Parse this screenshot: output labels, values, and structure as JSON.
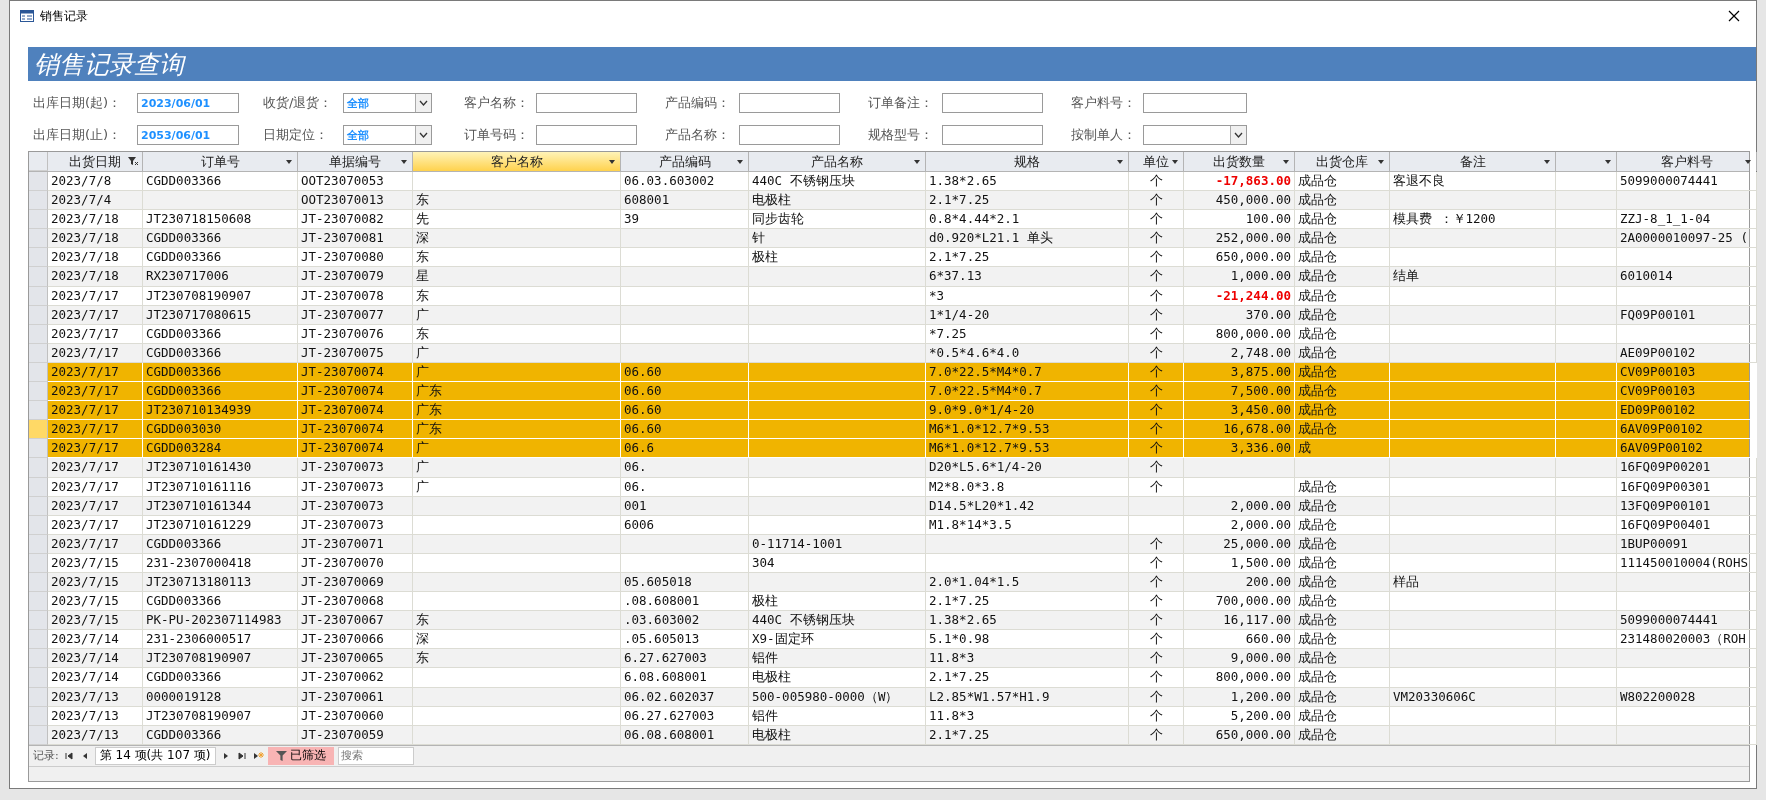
{
  "window": {
    "title": "销售记录"
  },
  "banner": {
    "title": "销售记录查询"
  },
  "filters": [
    [
      {
        "label": "出库日期(起)：",
        "kind": "date",
        "value": "2023/06/01"
      },
      {
        "label": "收货/退货：",
        "kind": "combo",
        "value": "全部"
      },
      {
        "label": "客户名称：",
        "kind": "text"
      },
      {
        "label": "产品编码：",
        "kind": "text"
      },
      {
        "label": "订单备注：",
        "kind": "text"
      },
      {
        "label": "客户料号：",
        "kind": "text"
      }
    ],
    [
      {
        "label": "出库日期(止)：",
        "kind": "date",
        "value": "2053/06/01"
      },
      {
        "label": "日期定位：",
        "kind": "combo",
        "value": "全部"
      },
      {
        "label": "订单号码：",
        "kind": "text"
      },
      {
        "label": "产品名称：",
        "kind": "text"
      },
      {
        "label": "规格型号：",
        "kind": "text"
      },
      {
        "label": "按制单人：",
        "kind": "combo"
      }
    ]
  ],
  "table": {
    "columns": [
      {
        "label": "出货日期",
        "selected": false,
        "filtered": true
      },
      {
        "label": "订单号",
        "selected": false,
        "filtered": false
      },
      {
        "label": "单据编号",
        "selected": false,
        "filtered": false
      },
      {
        "label": "客户名称",
        "selected": true,
        "filtered": false
      },
      {
        "label": "产品编码",
        "selected": false,
        "filtered": false
      },
      {
        "label": "产品名称",
        "selected": false,
        "filtered": false
      },
      {
        "label": "规格",
        "selected": false,
        "filtered": false
      },
      {
        "label": "单位",
        "selected": false,
        "filtered": false
      },
      {
        "label": "出货数量",
        "selected": false,
        "filtered": false
      },
      {
        "label": "出货仓库",
        "selected": false,
        "filtered": false
      },
      {
        "label": "备注",
        "selected": false,
        "filtered": false
      },
      {
        "selected": false,
        "filtered": false
      },
      {
        "label": "客户料号",
        "selected": false,
        "filtered": false
      }
    ],
    "rows": [
      {
        "selected": false,
        "current": false,
        "negative": true,
        "ship_date": "2023/7/8",
        "order_no": "CGDD003366",
        "doc_no": "OOT23070053",
        "product_code": "06.03.603002",
        "product_name": "440C 不锈钢压块",
        "spec": "1.38*2.65",
        "unit": "个",
        "qty": "-17,863.00",
        "warehouse": "成品仓",
        "note": "客退不良",
        "customer_part": "5099000074441"
      },
      {
        "selected": false,
        "current": false,
        "negative": false,
        "ship_date": "2023/7/4",
        "doc_no": "OOT23070013",
        "customer": "东",
        "product_code": "608001",
        "product_name": "电极柱",
        "spec": "2.1*7.25",
        "unit": "个",
        "qty": "450,000.00",
        "warehouse": "成品仓"
      },
      {
        "selected": false,
        "current": false,
        "negative": false,
        "ship_date": "2023/7/18",
        "order_no": "JT230718150608",
        "doc_no": "JT-23070082",
        "customer": "先",
        "product_code": "39",
        "product_name": "同步齿轮",
        "spec": "0.8*4.44*2.1",
        "unit": "个",
        "qty": "100.00",
        "warehouse": "成品仓",
        "note": "模具费 ：￥1200",
        "customer_part": "ZZJ-8_1_1-04"
      },
      {
        "selected": false,
        "current": false,
        "negative": false,
        "ship_date": "2023/7/18",
        "order_no": "CGDD003366",
        "doc_no": "JT-23070081",
        "customer": "深",
        "product_name": "针",
        "spec": "d0.920*L21.1 单头",
        "unit": "个",
        "qty": "252,000.00",
        "warehouse": "成品仓",
        "customer_part": "2A0000010097-25 ("
      },
      {
        "selected": false,
        "current": false,
        "negative": false,
        "ship_date": "2023/7/18",
        "order_no": "CGDD003366",
        "doc_no": "JT-23070080",
        "customer": "东",
        "product_name": "极柱",
        "spec": "2.1*7.25",
        "unit": "个",
        "qty": "650,000.00",
        "warehouse": "成品仓"
      },
      {
        "selected": false,
        "current": false,
        "negative": false,
        "ship_date": "2023/7/18",
        "order_no": "RX230717006",
        "doc_no": "JT-23070079",
        "customer": "星",
        "spec": "6*37.13",
        "unit": "个",
        "qty": "1,000.00",
        "warehouse": "成品仓",
        "note": "结单",
        "customer_part": "6010014"
      },
      {
        "selected": false,
        "current": false,
        "negative": true,
        "ship_date": "2023/7/17",
        "order_no": "JT230708190907",
        "doc_no": "JT-23070078",
        "customer": "东",
        "spec": "*3",
        "unit": "个",
        "qty": "-21,244.00",
        "warehouse": "成品仓"
      },
      {
        "selected": false,
        "current": false,
        "negative": false,
        "ship_date": "2023/7/17",
        "order_no": "JT230717080615",
        "doc_no": "JT-23070077",
        "customer": "广",
        "spec": "1*1/4-20",
        "unit": "个",
        "qty": "370.00",
        "warehouse": "成品仓",
        "customer_part": "FQ09P00101"
      },
      {
        "selected": false,
        "current": false,
        "negative": false,
        "ship_date": "2023/7/17",
        "order_no": "CGDD003366",
        "doc_no": "JT-23070076",
        "customer": "东",
        "spec": "*7.25",
        "unit": "个",
        "qty": "800,000.00",
        "warehouse": "成品仓"
      },
      {
        "selected": false,
        "current": false,
        "negative": false,
        "ship_date": "2023/7/17",
        "order_no": "CGDD003366",
        "doc_no": "JT-23070075",
        "customer": "广",
        "spec": "*0.5*4.6*4.0",
        "unit": "个",
        "qty": "2,748.00",
        "warehouse": "成品仓",
        "customer_part": "AE09P00102"
      },
      {
        "selected": true,
        "current": false,
        "negative": false,
        "ship_date": "2023/7/17",
        "order_no": "CGDD003366",
        "doc_no": "JT-23070074",
        "customer": "广",
        "product_code": "06.60",
        "spec": "7.0*22.5*M4*0.7",
        "unit": "个",
        "qty": "3,875.00",
        "warehouse": "成品仓",
        "customer_part": "CV09P00103"
      },
      {
        "selected": true,
        "current": false,
        "negative": false,
        "ship_date": "2023/7/17",
        "order_no": "CGDD003366",
        "doc_no": "JT-23070074",
        "customer": "广东",
        "product_code": "06.60",
        "spec": "7.0*22.5*M4*0.7",
        "unit": "个",
        "qty": "7,500.00",
        "warehouse": "成品仓",
        "customer_part": "CV09P00103"
      },
      {
        "selected": true,
        "current": false,
        "negative": false,
        "ship_date": "2023/7/17",
        "order_no": "JT230710134939",
        "doc_no": "JT-23070074",
        "customer": "广东",
        "product_code": "06.60",
        "spec": "9.0*9.0*1/4-20",
        "unit": "个",
        "qty": "3,450.00",
        "warehouse": "成品仓",
        "customer_part": "ED09P00102"
      },
      {
        "selected": true,
        "current": true,
        "negative": false,
        "ship_date": "2023/7/17",
        "order_no": "CGDD003030",
        "doc_no": "JT-23070074",
        "customer": "广东",
        "product_code": "06.60",
        "spec": "M6*1.0*12.7*9.53",
        "unit": "个",
        "qty": "16,678.00",
        "warehouse": "成品仓",
        "customer_part": "6AV09P00102"
      },
      {
        "selected": true,
        "current": false,
        "negative": false,
        "ship_date": "2023/7/17",
        "order_no": "CGDD003284",
        "doc_no": "JT-23070074",
        "customer": "广",
        "product_code": "06.6",
        "spec": "M6*1.0*12.7*9.53",
        "unit": "个",
        "qty": "3,336.00",
        "warehouse": "成",
        "customer_part": "6AV09P00102"
      },
      {
        "selected": false,
        "current": false,
        "negative": false,
        "ship_date": "2023/7/17",
        "order_no": "JT230710161430",
        "doc_no": "JT-23070073",
        "customer": "广",
        "product_code": "06.",
        "spec": "D20*L5.6*1/4-20",
        "unit": "个",
        "customer_part": "16FQ09P00201"
      },
      {
        "selected": false,
        "current": false,
        "negative": false,
        "ship_date": "2023/7/17",
        "order_no": "JT230710161116",
        "doc_no": "JT-23070073",
        "customer": "广",
        "product_code": "06.",
        "spec": "M2*8.0*3.8",
        "unit": "个",
        "warehouse": "成品仓",
        "customer_part": "16FQ09P00301"
      },
      {
        "selected": false,
        "current": false,
        "negative": false,
        "ship_date": "2023/7/17",
        "order_no": "JT230710161344",
        "doc_no": "JT-23070073",
        "product_code": "001",
        "spec": "D14.5*L20*1.42",
        "qty": "2,000.00",
        "warehouse": "成品仓",
        "customer_part": "13FQ09P00101"
      },
      {
        "selected": false,
        "current": false,
        "negative": false,
        "ship_date": "2023/7/17",
        "order_no": "JT230710161229",
        "doc_no": "JT-23070073",
        "product_code": "6006",
        "spec": "M1.8*14*3.5",
        "qty": "2,000.00",
        "warehouse": "成品仓",
        "customer_part": "16FQ09P00401"
      },
      {
        "selected": false,
        "current": false,
        "negative": false,
        "ship_date": "2023/7/17",
        "order_no": "CGDD003366",
        "doc_no": "JT-23070071",
        "product_name": "0-11714-1001",
        "unit": "个",
        "qty": "25,000.00",
        "warehouse": "成品仓",
        "customer_part": "1BUP00091"
      },
      {
        "selected": false,
        "current": false,
        "negative": false,
        "ship_date": "2023/7/15",
        "order_no": "231-2307000418",
        "doc_no": "JT-23070070",
        "product_name": "304",
        "unit": "个",
        "qty": "1,500.00",
        "warehouse": "成品仓",
        "customer_part": "111450010004(ROHS"
      },
      {
        "selected": false,
        "current": false,
        "negative": false,
        "ship_date": "2023/7/15",
        "order_no": "JT230713180113",
        "doc_no": "JT-23070069",
        "product_code": "05.605018",
        "spec": "2.0*1.04*1.5",
        "unit": "个",
        "qty": "200.00",
        "warehouse": "成品仓",
        "note": "样品"
      },
      {
        "selected": false,
        "current": false,
        "negative": false,
        "ship_date": "2023/7/15",
        "order_no": "CGDD003366",
        "doc_no": "JT-23070068",
        "product_code": ".08.608001",
        "product_name": "极柱",
        "spec": "2.1*7.25",
        "unit": "个",
        "qty": "700,000.00",
        "warehouse": "成品仓"
      },
      {
        "selected": false,
        "current": false,
        "negative": false,
        "ship_date": "2023/7/15",
        "order_no": "PK-PU-202307114983",
        "doc_no": "JT-23070067",
        "customer": "东",
        "product_code": ".03.603002",
        "product_name": "440C 不锈钢压块",
        "spec": "1.38*2.65",
        "unit": "个",
        "qty": "16,117.00",
        "warehouse": "成品仓",
        "customer_part": "5099000074441"
      },
      {
        "selected": false,
        "current": false,
        "negative": false,
        "ship_date": "2023/7/14",
        "order_no": "231-2306000517",
        "doc_no": "JT-23070066",
        "customer": "深",
        "product_code": ".05.605013",
        "product_name": "X9-固定环",
        "spec": "5.1*0.98",
        "unit": "个",
        "qty": "660.00",
        "warehouse": "成品仓",
        "customer_part": "231480020003（ROH"
      },
      {
        "selected": false,
        "current": false,
        "negative": false,
        "ship_date": "2023/7/14",
        "order_no": "JT230708190907",
        "doc_no": "JT-23070065",
        "customer": "东",
        "product_code": "6.27.627003",
        "product_name": "铝件",
        "spec": "11.8*3",
        "unit": "个",
        "qty": "9,000.00",
        "warehouse": "成品仓"
      },
      {
        "selected": false,
        "current": false,
        "negative": false,
        "ship_date": "2023/7/14",
        "order_no": "CGDD003366",
        "doc_no": "JT-23070062",
        "product_code": "6.08.608001",
        "product_name": "电极柱",
        "spec": "2.1*7.25",
        "unit": "个",
        "qty": "800,000.00",
        "warehouse": "成品仓"
      },
      {
        "selected": false,
        "current": false,
        "negative": false,
        "ship_date": "2023/7/13",
        "order_no": "0000019128",
        "doc_no": "JT-23070061",
        "product_code": "06.02.602037",
        "product_name": "500-005980-0000（W）",
        "spec": "L2.85*W1.57*H1.9",
        "unit": "个",
        "qty": "1,200.00",
        "warehouse": "成品仓",
        "note": "VM20330606C",
        "customer_part": "W802200028"
      },
      {
        "selected": false,
        "current": false,
        "negative": false,
        "ship_date": "2023/7/13",
        "order_no": "JT230708190907",
        "doc_no": "JT-23070060",
        "product_code": "06.27.627003",
        "product_name": "铝件",
        "spec": "11.8*3",
        "unit": "个",
        "qty": "5,200.00",
        "warehouse": "成品仓"
      },
      {
        "selected": false,
        "current": false,
        "negative": false,
        "ship_date": "2023/7/13",
        "order_no": "CGDD003366",
        "doc_no": "JT-23070059",
        "product_code": "06.08.608001",
        "product_name": "电极柱",
        "spec": "2.1*7.25",
        "unit": "个",
        "qty": "650,000.00",
        "warehouse": "成品仓"
      }
    ]
  },
  "navigator": {
    "label": "记录:",
    "position": "第 14 项(共 107 项)",
    "filter": {
      "label": "已筛选",
      "on": true
    },
    "search": {
      "placeholder": "搜索"
    }
  }
}
